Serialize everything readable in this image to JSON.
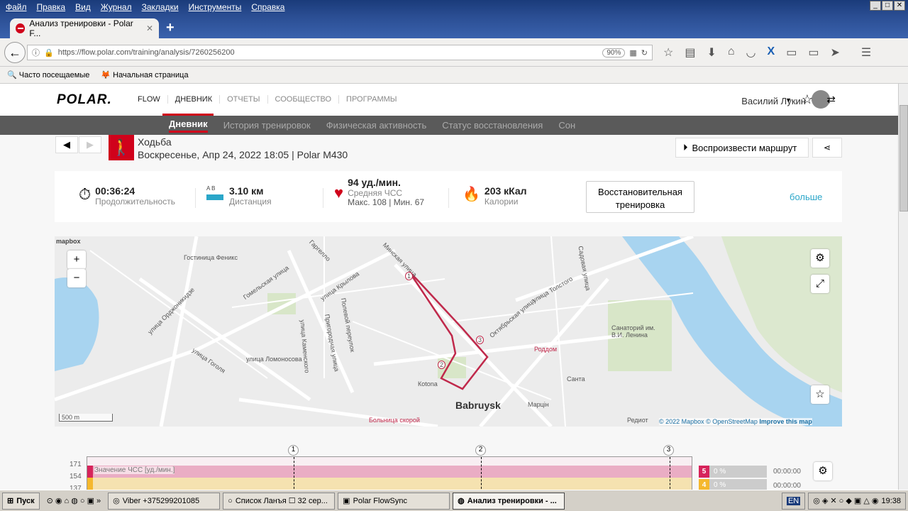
{
  "browser": {
    "menu": [
      "Файл",
      "Правка",
      "Вид",
      "Журнал",
      "Закладки",
      "Инструменты",
      "Справка"
    ],
    "tab_title": "Анализ тренировки - Polar F...",
    "url": "https://flow.polar.com/training/analysis/7260256200",
    "zoom": "90%",
    "bookmarks": [
      "Часто посещаемые",
      "Начальная страница"
    ]
  },
  "header": {
    "logo": "POLAR.",
    "flow": "FLOW",
    "nav": [
      "ДНЕВНИК",
      "ОТЧЕТЫ",
      "СООБЩЕСТВО",
      "ПРОГРАММЫ"
    ],
    "user": "Василий Лукин"
  },
  "subnav": [
    "Дневник",
    "История тренировок",
    "Физическая активность",
    "Статус восстановления",
    "Сон"
  ],
  "training": {
    "sport": "Ходьба",
    "date": "Воскресенье, Апр 24, 2022 18:05 | Polar M430",
    "play": "Воспроизвести маршрут"
  },
  "summary": {
    "duration": "00:36:24",
    "duration_label": "Продолжительность",
    "ab": "A  B",
    "distance": "3.10 км",
    "distance_label": "Дистанция",
    "hr": "94 уд./мин.",
    "hr_label": "Средняя ЧСС",
    "hr_range": "Макс. 108  |  Мин. 67",
    "calories": "203 кКал",
    "calories_label": "Калории",
    "benefit": "Восстановительная тренировка",
    "more": "больше"
  },
  "map": {
    "attribution_logo": "mapbox",
    "scale": "500 m",
    "copyright": "© 2022 Mapbox © OpenStreetMap",
    "improve": "Improve this map",
    "labels": [
      "Гостиница Феникс",
      "улица Орджоникидзе",
      "Гомельская улица",
      "улица Крылова",
      "улица Гоголя",
      "улица Ломоносова",
      "Пригородная улица",
      "Полевой переулок",
      "Минская улица",
      "Октябрьская улица",
      "улица Толстого",
      "Садовая улица",
      "Роддом",
      "Санаторий им. В.И. Ленина",
      "Санта",
      "Марцін",
      "Коtona",
      "Bobruysk",
      "Больница скорой",
      "Редиот",
      "улица Каменского",
      "Гаргелло"
    ],
    "city": "Babruysk",
    "markers": [
      "1",
      "2",
      "3"
    ]
  },
  "chart": {
    "yticks": [
      "171",
      "154",
      "137"
    ],
    "series_label": "Значение ЧСС [уд./мин.]",
    "laps": [
      "1",
      "2",
      "3"
    ],
    "zones": [
      {
        "n": "5",
        "pct": "0 %",
        "time": "00:00:00",
        "color": "#d6245b"
      },
      {
        "n": "4",
        "pct": "0 %",
        "time": "00:00:00",
        "color": "#f5b82e"
      }
    ]
  },
  "taskbar": {
    "start": "Пуск",
    "tasks": [
      "Viber +375299201085",
      "Список Ланъя ☐ 32 сер...",
      "Polar FlowSync",
      "Анализ тренировки - ..."
    ],
    "lang": "EN",
    "clock": "19:38"
  }
}
